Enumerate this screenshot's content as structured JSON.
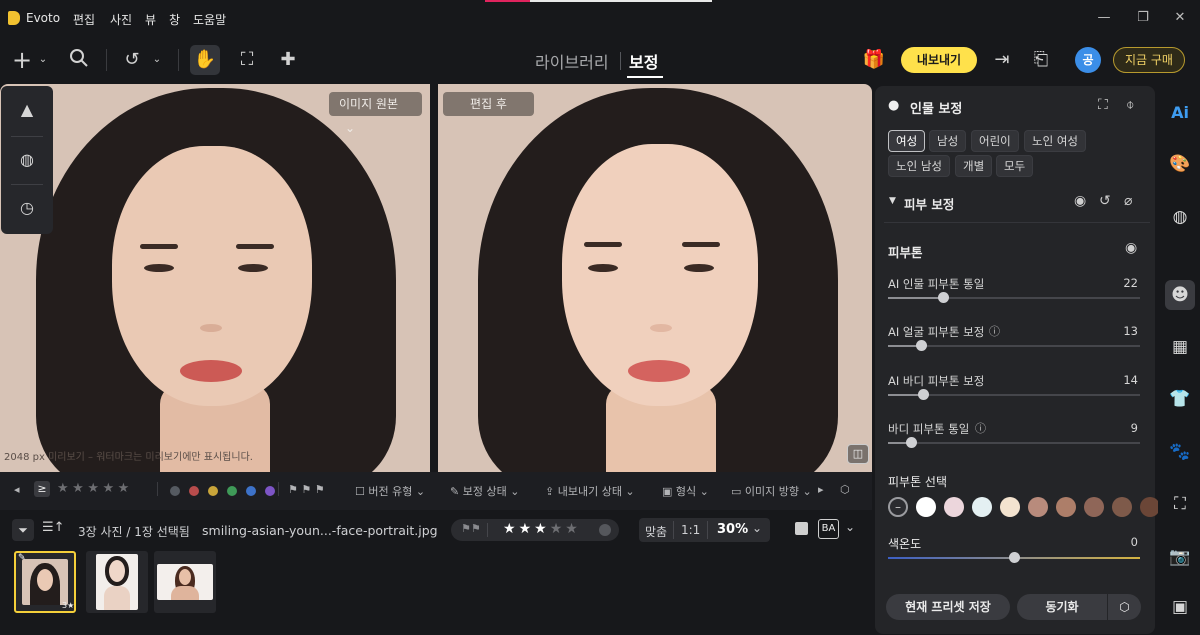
{
  "app": {
    "name": "Evoto",
    "menu": [
      "편집",
      "사진",
      "뷰",
      "창",
      "도움말"
    ]
  },
  "toolbar": {
    "tab_library": "라이브러리",
    "tab_retouch": "보정",
    "export_label": "내보내기",
    "avatar_initial": "공",
    "buy_label": "지금 구매"
  },
  "canvas": {
    "before_dropdown": "이미지 원본",
    "after_label": "편집 후",
    "watermark_text": "2048 px 미리보기 – 워터마크는 미리보기에만 표시됩니다."
  },
  "filter_bar": {
    "rating_op": "≥",
    "color_labels": [
      "#555a61",
      "#b84c4c",
      "#c9a53a",
      "#3f9a58",
      "#3d72c9",
      "#7d55c6"
    ],
    "version_type": "버전 유형",
    "retouch_status": "보정 상태",
    "export_status": "내보내기 상태",
    "format": "형식",
    "orientation": "이미지 방향"
  },
  "info_bar": {
    "count": "3장 사진 / 1장 선택됨",
    "filename": "smiling-asian-youn...-face-portrait.jpg",
    "rating": 3,
    "rating_max": 5,
    "fit": "맞춤",
    "ratio": "1:1",
    "zoom": "30%"
  },
  "thumbnails": [
    {
      "name": "thumb-1",
      "stars": "3★",
      "active": true
    },
    {
      "name": "thumb-2",
      "active": false
    },
    {
      "name": "thumb-3",
      "active": false
    }
  ],
  "panel": {
    "title": "인물 보정",
    "groups": [
      "여성",
      "남성",
      "어린이",
      "노인 여성",
      "노인 남성",
      "개별",
      "모두"
    ],
    "selected_group": "여성",
    "section": "피부 보정",
    "subsection": "피부톤",
    "sliders": [
      {
        "label": "AI 인물 피부톤 통일",
        "value": "22",
        "ratio": 0.22
      },
      {
        "label": "AI 얼굴 피부톤 보정",
        "value": "13",
        "ratio": 0.13
      },
      {
        "label": "AI 바디 피부톤 보정",
        "value": "14",
        "ratio": 0.14
      },
      {
        "label": "바디 피부톤 통일",
        "value": "9",
        "ratio": 0.09
      }
    ],
    "tone_select_label": "피부톤 선택",
    "swatches": [
      "#ffffff",
      "#ecd6dc",
      "#e4f0f2",
      "#f3e3cf",
      "#b88b7c",
      "#ad7e69",
      "#8f6658",
      "#7e5a4a",
      "#6b4637"
    ],
    "color_temp_label": "색온도",
    "color_temp_value": "0",
    "save_preset": "현재 프리셋 저장",
    "sync": "동기화"
  }
}
